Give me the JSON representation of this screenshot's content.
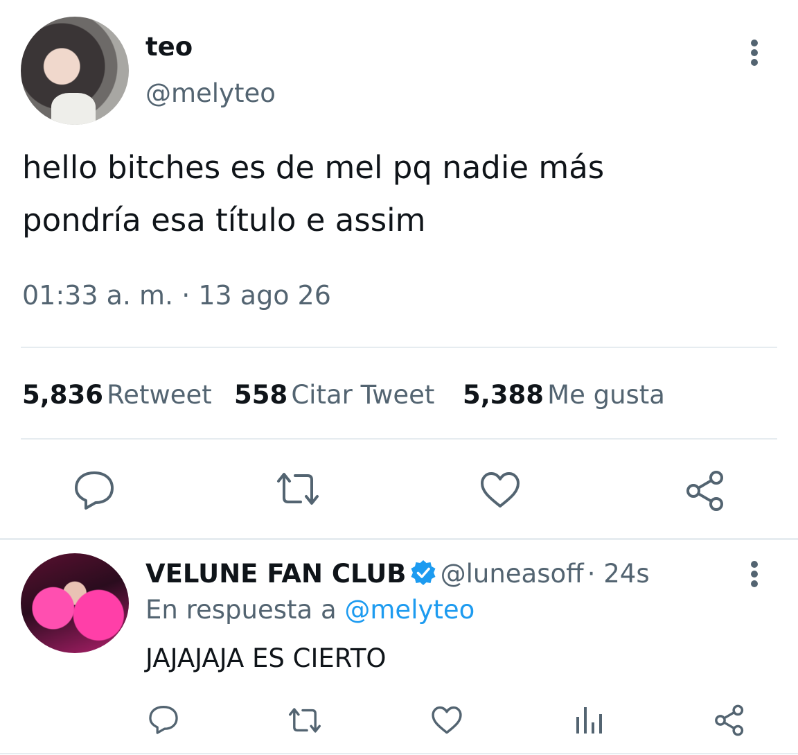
{
  "tweet": {
    "author_name": "teo",
    "author_handle": "@melyteo",
    "text_line1": "hello bitches es de mel pq nadie más",
    "text_line2": "pondría esa título e assim",
    "timestamp": "01:33 a. m. · 13 ago 26",
    "stats": {
      "retweets_count": "5,836",
      "retweets_label": "Retweet",
      "quotes_count": "558",
      "quotes_label": "Citar Tweet",
      "likes_count": "5,388",
      "likes_label": "Me gusta"
    }
  },
  "reply": {
    "author_name": "VELUNE FAN CLUB",
    "author_handle": "@luneasoff",
    "time_ago": "· 24s",
    "replying_prefix": "En respuesta a",
    "replying_to": "@melyteo",
    "text": "JAJAJAJA ES CIERTO"
  },
  "icons": {
    "reply": "reply-icon",
    "retweet": "retweet-icon",
    "like": "heart-icon",
    "share": "share-icon",
    "analytics": "analytics-icon",
    "more": "more-vertical-icon",
    "verified": "verified-badge-icon"
  },
  "colors": {
    "text_primary": "#0f1419",
    "text_secondary": "#536471",
    "link": "#1d9bf0",
    "divider": "#e6ecf0"
  }
}
